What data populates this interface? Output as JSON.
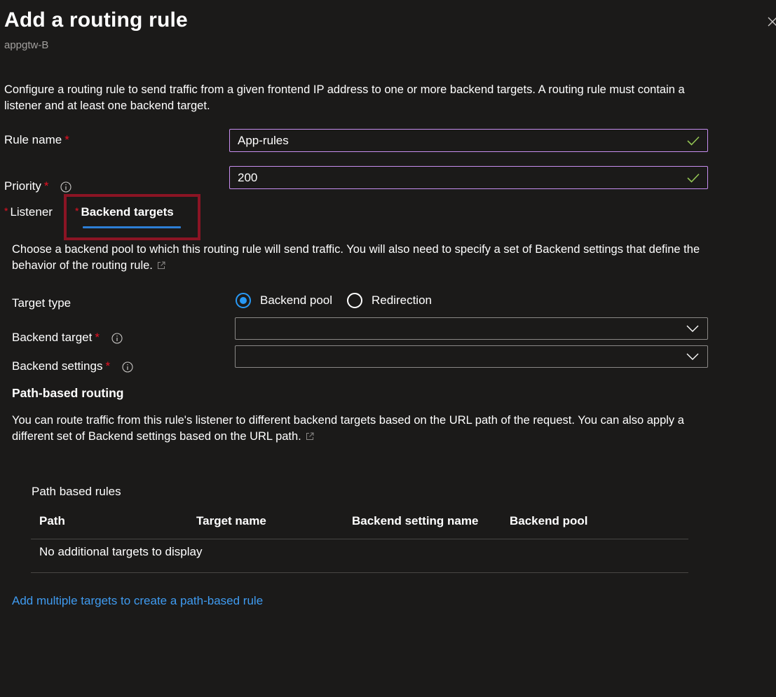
{
  "header": {
    "title": "Add a routing rule",
    "subtitle": "appgtw-B"
  },
  "intro": {
    "text": "Configure a routing rule to send traffic from a given frontend IP address to one or more backend targets. A routing rule must contain a listener and at least one backend target."
  },
  "form": {
    "rule_name": {
      "label": "Rule name",
      "required": "*",
      "value": "App-rules"
    },
    "priority": {
      "label": "Priority",
      "required": "*",
      "value": "200"
    }
  },
  "tabs": [
    {
      "star": "*",
      "label": "Listener",
      "selected": false
    },
    {
      "star": "*",
      "label": "Backend targets",
      "selected": true
    }
  ],
  "backend": {
    "description": "Choose a backend pool to which this routing rule will send traffic. You will also need to specify a set of Backend settings that define the behavior of the routing rule.",
    "target_type": {
      "label": "Target type",
      "options": [
        {
          "label": "Backend pool",
          "selected": true
        },
        {
          "label": "Redirection",
          "selected": false
        }
      ]
    },
    "backend_target": {
      "label": "Backend target",
      "required": "*",
      "value": ""
    },
    "backend_settings": {
      "label": "Backend settings",
      "required": "*",
      "value": ""
    }
  },
  "path_routing": {
    "heading": "Path-based routing",
    "description": "You can route traffic from this rule's listener to different backend targets based on the URL path of the request. You can also apply a different set of Backend settings based on the URL path.",
    "table_title": "Path based rules",
    "columns": [
      "Path",
      "Target name",
      "Backend setting name",
      "Backend pool"
    ],
    "empty_text": "No additional targets to display",
    "add_link": "Add multiple targets to create a path-based rule"
  },
  "colors": {
    "background": "#1b1a19",
    "accent": "#2899f5",
    "link": "#3f9bf0",
    "required": "#e81123",
    "valid_check": "#92c353",
    "highlight_box": "#8b1424",
    "input_focus_border": "#c78ef0"
  },
  "icons": [
    "close-icon",
    "checkmark-icon",
    "info-icon",
    "chevron-down-icon",
    "external-link-icon"
  ]
}
